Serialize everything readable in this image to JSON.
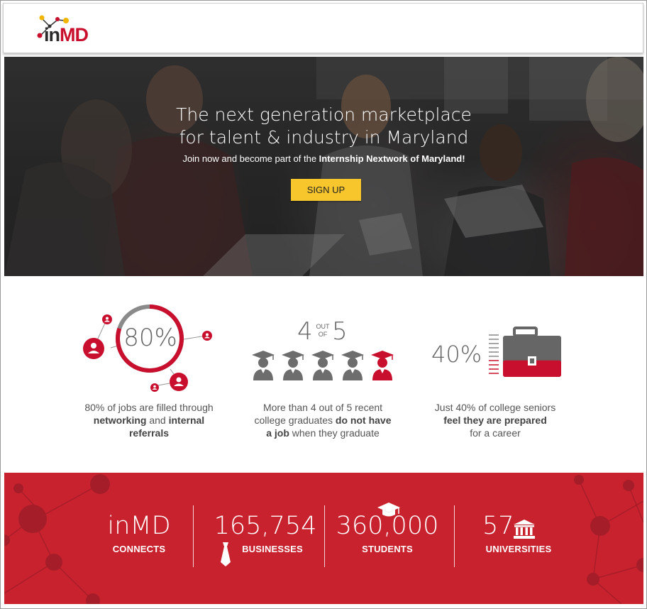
{
  "header": {
    "logo_in": "in",
    "logo_md": "MD"
  },
  "hero": {
    "title_line1": "The next generation marketplace",
    "title_line2": "for talent & industry in Maryland",
    "subtitle_prefix": "Join now and become part of the ",
    "subtitle_bold": "Internship Nextwork of Maryland!",
    "cta": "SIGN UP"
  },
  "stats": {
    "jobs": {
      "pct": "80%",
      "ring_fill": 0.8,
      "line1": "80% of jobs are filled through",
      "line2_bold1": "networking",
      "line2_mid": " and ",
      "line2_bold2": "internal",
      "line3_bold": "referrals"
    },
    "grads": {
      "num": "4",
      "out": "OUT",
      "of": "OF",
      "den": "5",
      "line1": "More than 4 out of 5 recent",
      "line2": "college graduates ",
      "line2_bold": "do not have",
      "line3_bold": "a job",
      "line3": " when they graduate"
    },
    "seniors": {
      "pct": "40%",
      "level": 0.4,
      "line1": "Just 40% of college seniors",
      "line2_bold": "feel they are prepared",
      "line3": "for a career"
    }
  },
  "band": {
    "brand": "inMD",
    "brand_label": "CONNECTS",
    "businesses_num": "165,754",
    "businesses_label": "BUSINESSES",
    "students_num": "360,000",
    "students_label": "STUDENTS",
    "universities_num": "57",
    "universities_label": "UNIVERSITIES"
  },
  "colors": {
    "brand_red": "#c8102e",
    "band_red": "#c8222f",
    "cta_yellow": "#f7c52c",
    "icon_gray": "#6d6d6d"
  }
}
